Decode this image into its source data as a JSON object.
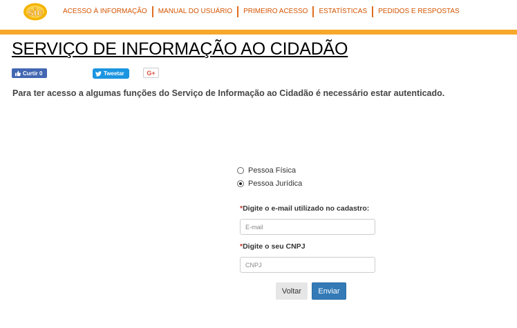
{
  "header": {
    "nav": [
      {
        "label": "ACESSO À INFORMAÇÃO"
      },
      {
        "label": "MANUAL DO USUÁRIO"
      },
      {
        "label": "PRIMEIRO ACESSO"
      },
      {
        "label": "ESTATÍSTICAS"
      },
      {
        "label": "PEDIDOS E RESPOSTAS"
      }
    ],
    "accent_color": "#f7a72a",
    "nav_color": "#d35400"
  },
  "page": {
    "title": "SERVIÇO DE INFORMAÇÃO AO CIDADÃO",
    "notice": "Para ter acesso a algumas funções do Serviço de Informação ao Cidadão é necessário estar autenticado."
  },
  "social": {
    "facebook_label": "Curtir 0",
    "twitter_label": "Tweetar",
    "google_label": "G+"
  },
  "form": {
    "person_types": [
      {
        "label": "Pessoa Física",
        "selected": false
      },
      {
        "label": "Pessoa Jurídica",
        "selected": true
      }
    ],
    "email_label": "Digite o e-mail utilizado no cadastro:",
    "email_placeholder": "E-mail",
    "cnpj_label": "Digite o seu CNPJ",
    "cnpj_placeholder": "CNPJ",
    "required_mark": "*",
    "back_label": "Voltar",
    "submit_label": "Enviar"
  }
}
